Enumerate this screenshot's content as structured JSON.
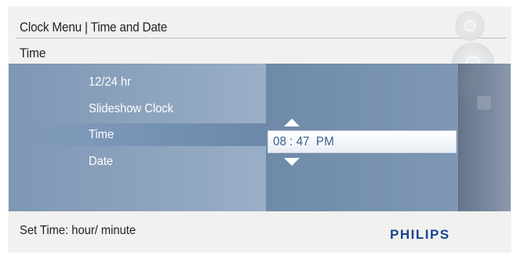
{
  "header": {
    "title": "Clock Menu | Time and  Date",
    "subtitle": "Time"
  },
  "menu": {
    "items": [
      {
        "label": "12/24 hr",
        "selected": false
      },
      {
        "label": "Slideshow Clock",
        "selected": false
      },
      {
        "label": "Time",
        "selected": true
      },
      {
        "label": "Date",
        "selected": false
      }
    ]
  },
  "time_field": {
    "hour": "08",
    "separator": ":",
    "minute": "47",
    "ampm": "PM",
    "display": "08 : 47  PM"
  },
  "footer": {
    "hint": "Set Time: hour/ minute",
    "brand": "PHILIPS"
  },
  "colors": {
    "brand": "#17478e",
    "panel_blue": "#8fa6bf",
    "highlight_blue": "#6b88aa",
    "time_text": "#3a5f8f"
  },
  "icons": [
    "arrow-up-icon",
    "arrow-down-icon",
    "dial-icon",
    "joystick-icon",
    "back-icon"
  ]
}
